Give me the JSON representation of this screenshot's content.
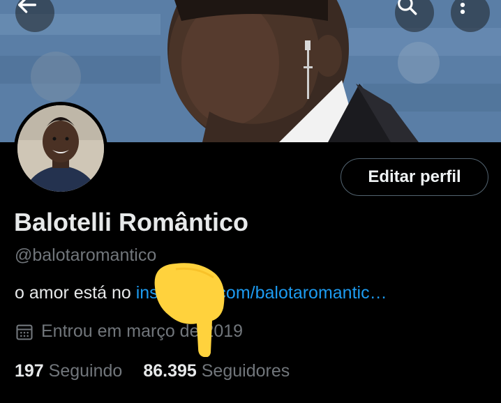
{
  "header": {
    "back_icon": "arrow-left-icon",
    "search_icon": "search-icon",
    "more_icon": "more-vertical-icon"
  },
  "profile": {
    "display_name": "Balotelli Romântico",
    "handle": "@balotaromantico",
    "bio_text": "o amor está no ",
    "bio_link": "instagram.com/balotaromantic…",
    "joined_icon": "calendar-icon",
    "joined": "Entrou em março de 2019",
    "edit_label": "Editar perfil"
  },
  "stats": {
    "following_count": "197",
    "following_label": "Seguindo",
    "followers_count": "86.395",
    "followers_label": "Seguidores"
  },
  "colors": {
    "background": "#000000",
    "accent": "#1d9bf0",
    "secondary_text": "#71767b",
    "primary_text": "#e7e9ea",
    "emoji": "#ffd23d"
  }
}
